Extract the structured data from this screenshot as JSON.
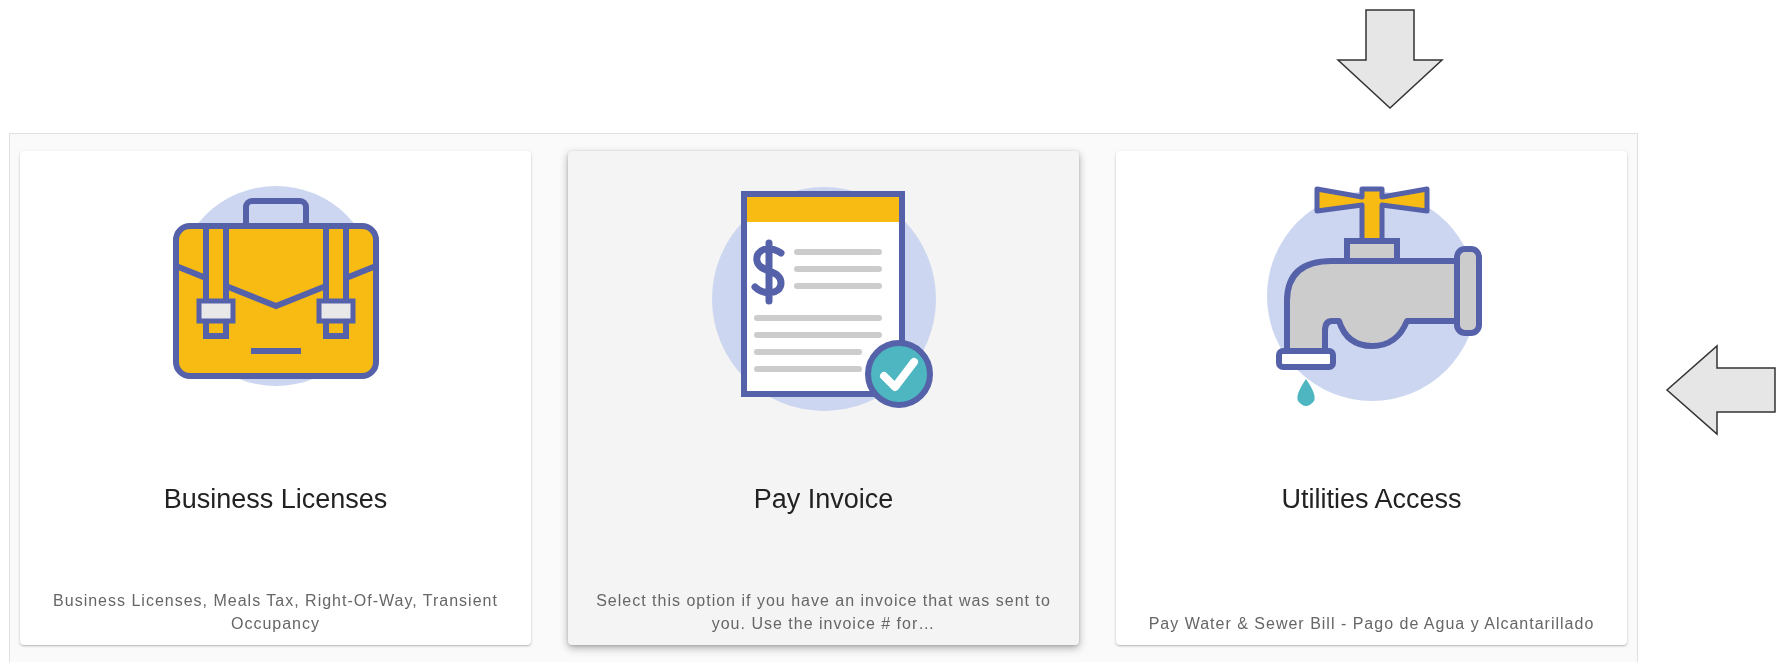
{
  "annotations": [
    {
      "kind": "down-arrow"
    },
    {
      "kind": "left-arrow"
    }
  ],
  "cards": [
    {
      "kind": "briefcase",
      "title": "Business Licenses",
      "description": "Business Licenses, Meals Tax, Right-Of-Way, Transient Occupancy",
      "highlighted": false
    },
    {
      "kind": "invoice",
      "title": "Pay Invoice",
      "description": "Select this option if you have an invoice that was sent to you. Use the invoice # for…",
      "highlighted": true
    },
    {
      "kind": "faucet",
      "title": "Utilities Access",
      "description": "Pay Water & Sewer Bill - Pago de Agua y Alcantarillado",
      "highlighted": false
    }
  ]
}
